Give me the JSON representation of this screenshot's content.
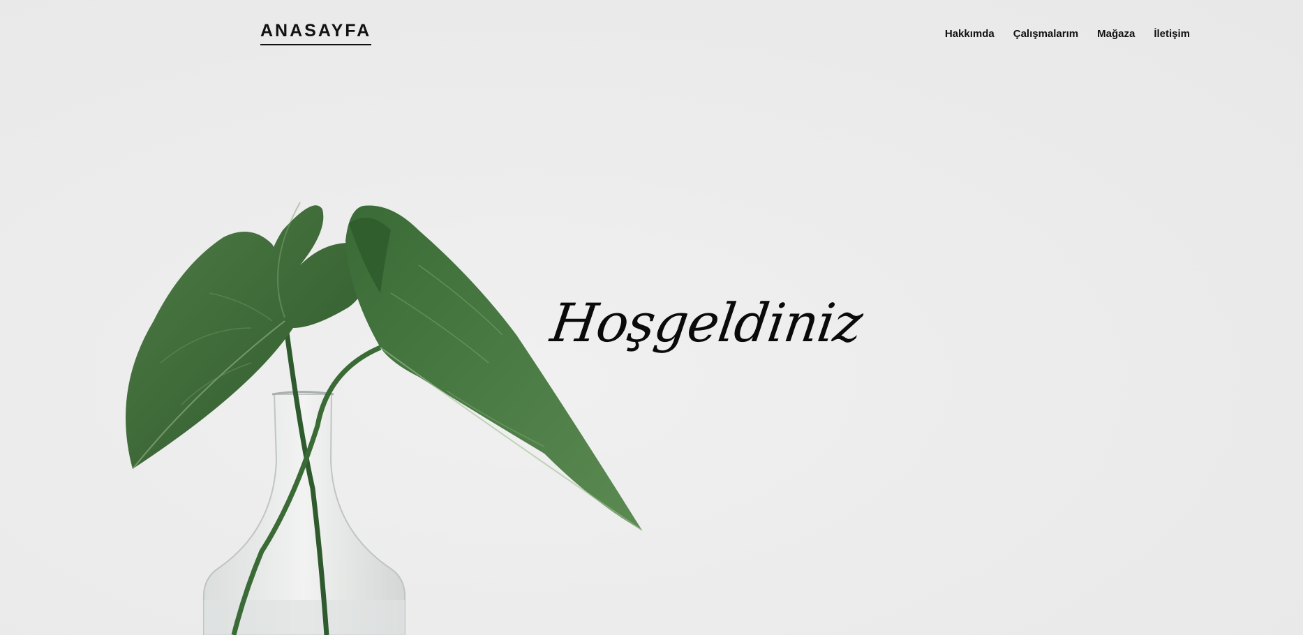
{
  "header": {
    "brand": "ANASAYFA",
    "nav": [
      {
        "label": "Hakkımda"
      },
      {
        "label": "Çalışmalarım"
      },
      {
        "label": "Mağaza"
      },
      {
        "label": "İletişim"
      }
    ]
  },
  "hero": {
    "title": "Hoşgeldiniz",
    "image": "plant-in-glass-vase",
    "colors": {
      "background": "#ebebeb",
      "leaf": "#3f6b3a",
      "text": "#111111"
    }
  }
}
